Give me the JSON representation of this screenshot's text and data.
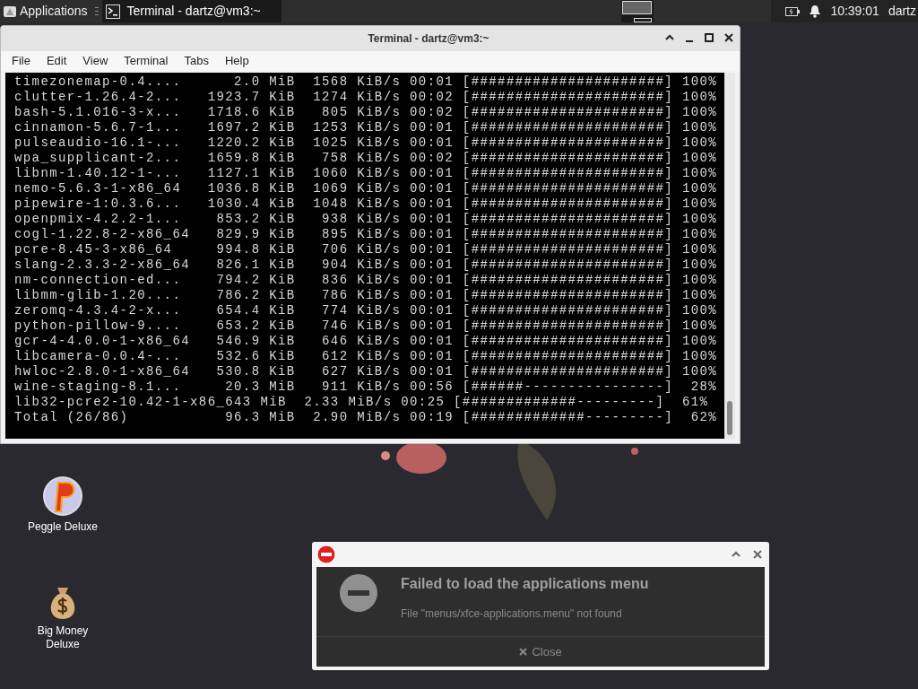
{
  "top_panel": {
    "applications_label": "Applications",
    "task_button": {
      "label": "Terminal - dartz@vm3:~",
      "selected": true
    },
    "clock": "10:39:01",
    "user": "dartz"
  },
  "terminal": {
    "title": "Terminal - dartz@vm3:~",
    "menu": [
      "File",
      "Edit",
      "View",
      "Terminal",
      "Tabs",
      "Help"
    ],
    "lines": [
      "timezonemap-0.4....      2.0 MiB  1568 KiB/s 00:01 [######################] 100%",
      "clutter-1.26.4-2...   1923.7 KiB  1274 KiB/s 00:02 [######################] 100%",
      "bash-5.1.016-3-x...   1718.6 KiB   805 KiB/s 00:02 [######################] 100%",
      "cinnamon-5.6.7-1...   1697.2 KiB  1253 KiB/s 00:01 [######################] 100%",
      "pulseaudio-16.1-...   1220.2 KiB  1025 KiB/s 00:01 [######################] 100%",
      "wpa_supplicant-2...   1659.8 KiB   758 KiB/s 00:02 [######################] 100%",
      "libnm-1.40.12-1-...   1127.1 KiB  1060 KiB/s 00:01 [######################] 100%",
      "nemo-5.6.3-1-x86_64   1036.8 KiB  1069 KiB/s 00:01 [######################] 100%",
      "pipewire-1:0.3.6...   1030.4 KiB  1048 KiB/s 00:01 [######################] 100%",
      "openpmix-4.2.2-1...    853.2 KiB   938 KiB/s 00:01 [######################] 100%",
      "cogl-1.22.8-2-x86_64   829.9 KiB   895 KiB/s 00:01 [######################] 100%",
      "pcre-8.45-3-x86_64     994.8 KiB   706 KiB/s 00:01 [######################] 100%",
      "slang-2.3.3-2-x86_64   826.1 KiB   904 KiB/s 00:01 [######################] 100%",
      "nm-connection-ed...    794.2 KiB   836 KiB/s 00:01 [######################] 100%",
      "libmm-glib-1.20....    786.2 KiB   786 KiB/s 00:01 [######################] 100%",
      "zeromq-4.3.4-2-x...    654.4 KiB   774 KiB/s 00:01 [######################] 100%",
      "python-pillow-9....    653.2 KiB   746 KiB/s 00:01 [######################] 100%",
      "gcr-4-4.0.0-1-x86_64   546.9 KiB   646 KiB/s 00:01 [######################] 100%",
      "libcamera-0.0.4-...    532.6 KiB   612 KiB/s 00:01 [######################] 100%",
      "hwloc-2.8.0-1-x86_64   530.8 KiB   627 KiB/s 00:01 [######################] 100%",
      "wine-staging-8.1...     20.3 MiB   911 KiB/s 00:56 [######----------------]  28%",
      "lib32-pcre2-10.42-1-x86_643 MiB  2.33 MiB/s 00:25 [#############---------]  61%",
      "Total (26/86)           96.3 MiB  2.90 MiB/s 00:19 [#############---------]  62%"
    ]
  },
  "desktop_icons": [
    {
      "kind": "peggle",
      "label": "Peggle Deluxe"
    },
    {
      "kind": "money",
      "label": "Big Money Deluxe"
    }
  ],
  "notification": {
    "title": "Failed to load the applications menu",
    "body": "File \"menus/xfce-applications.menu\" not found",
    "button": "Close"
  }
}
